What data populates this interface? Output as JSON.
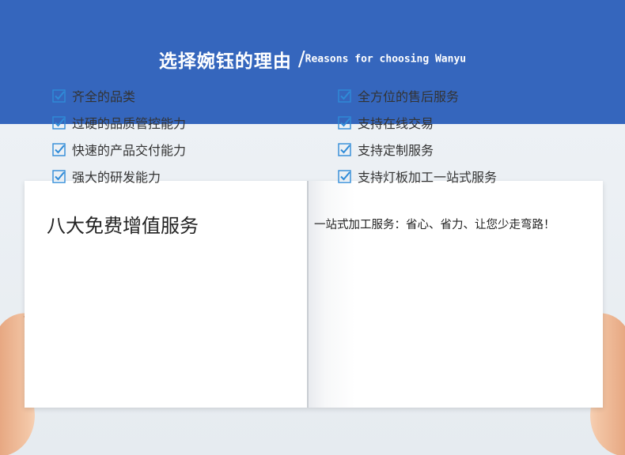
{
  "header": {
    "title_cn": "选择婉钰的理由",
    "slash": "/",
    "title_en": "Reasons for choosing Wanyu"
  },
  "left_panel": {
    "heading": "八大免费增值服务",
    "items": [
      "齐全的品类",
      "过硬的品质管控能力",
      "快速的产品交付能力",
      "强大的研发能力"
    ]
  },
  "right_panel": {
    "heading": "一站式加工服务：省心、省力、让您少走弯路！",
    "items": [
      "全方位的售后服务",
      "支持在线交易",
      "支持定制服务",
      "支持灯板加工一站式服务"
    ]
  },
  "colors": {
    "banner": "#3566bd",
    "checkbox": "#2f8bd8",
    "background": "#e9eef3"
  },
  "icons": {
    "checkbox": "checkbox-checked-icon",
    "hand": "hand-icon"
  }
}
